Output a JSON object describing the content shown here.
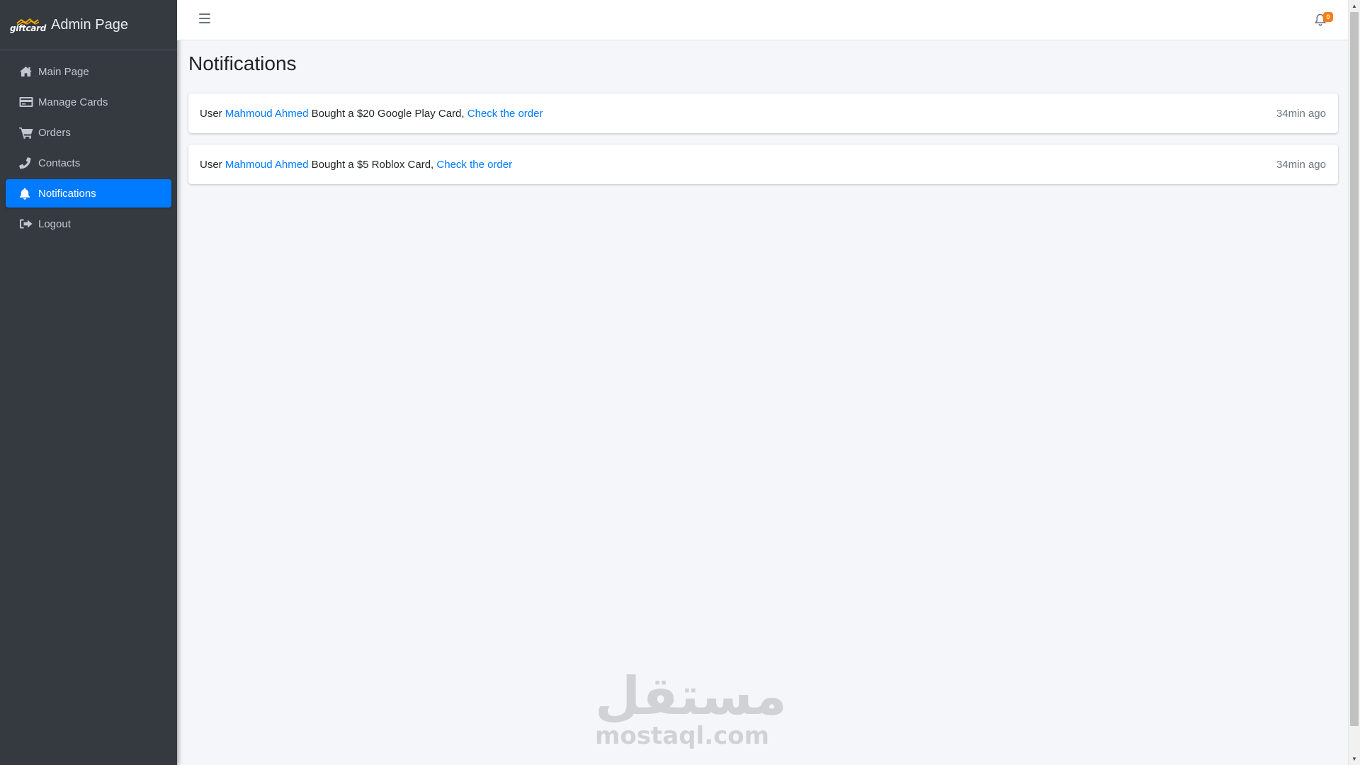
{
  "sidebar": {
    "brand_logo": "giftcard",
    "brand_title": "Admin Page",
    "items": [
      {
        "label": "Main Page",
        "icon": "home-icon"
      },
      {
        "label": "Manage Cards",
        "icon": "credit-card-icon"
      },
      {
        "label": "Orders",
        "icon": "shopping-cart-icon"
      },
      {
        "label": "Contacts",
        "icon": "phone-icon"
      },
      {
        "label": "Notifications",
        "icon": "bell-icon",
        "active": true
      },
      {
        "label": "Logout",
        "icon": "sign-out-icon"
      }
    ]
  },
  "topbar": {
    "menu_icon": "hamburger-menu-icon",
    "notification_icon": "bell-outline-icon",
    "notification_count": "0"
  },
  "main": {
    "page_title": "Notifications",
    "notifications": [
      {
        "prefix": "User",
        "user": "Mahmoud Ahmed",
        "text": "Bought a $20 Google Play Card,",
        "link": "Check the order",
        "time": "34min ago"
      },
      {
        "prefix": "User",
        "user": "Mahmoud Ahmed",
        "text": "Bought a $5 Roblox Card,",
        "link": "Check the order",
        "time": "34min ago"
      }
    ]
  },
  "watermark": {
    "arabic": "مستقل",
    "latin": "mostaql.com"
  },
  "colors": {
    "sidebar_bg": "#343a40",
    "accent": "#007bff",
    "content_bg": "#f4f6f9",
    "badge": "#fd7e14"
  }
}
